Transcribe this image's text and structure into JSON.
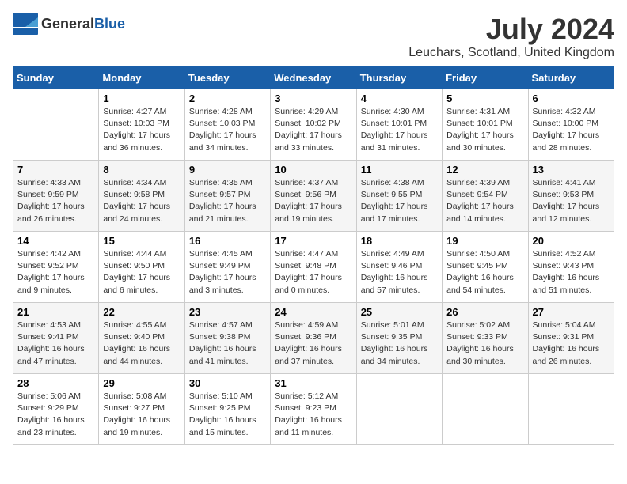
{
  "header": {
    "logo_general": "General",
    "logo_blue": "Blue",
    "title": "July 2024",
    "location": "Leuchars, Scotland, United Kingdom"
  },
  "weekdays": [
    "Sunday",
    "Monday",
    "Tuesday",
    "Wednesday",
    "Thursday",
    "Friday",
    "Saturday"
  ],
  "weeks": [
    [
      {
        "day": "",
        "details": ""
      },
      {
        "day": "1",
        "details": "Sunrise: 4:27 AM\nSunset: 10:03 PM\nDaylight: 17 hours\nand 36 minutes."
      },
      {
        "day": "2",
        "details": "Sunrise: 4:28 AM\nSunset: 10:03 PM\nDaylight: 17 hours\nand 34 minutes."
      },
      {
        "day": "3",
        "details": "Sunrise: 4:29 AM\nSunset: 10:02 PM\nDaylight: 17 hours\nand 33 minutes."
      },
      {
        "day": "4",
        "details": "Sunrise: 4:30 AM\nSunset: 10:01 PM\nDaylight: 17 hours\nand 31 minutes."
      },
      {
        "day": "5",
        "details": "Sunrise: 4:31 AM\nSunset: 10:01 PM\nDaylight: 17 hours\nand 30 minutes."
      },
      {
        "day": "6",
        "details": "Sunrise: 4:32 AM\nSunset: 10:00 PM\nDaylight: 17 hours\nand 28 minutes."
      }
    ],
    [
      {
        "day": "7",
        "details": "Sunrise: 4:33 AM\nSunset: 9:59 PM\nDaylight: 17 hours\nand 26 minutes."
      },
      {
        "day": "8",
        "details": "Sunrise: 4:34 AM\nSunset: 9:58 PM\nDaylight: 17 hours\nand 24 minutes."
      },
      {
        "day": "9",
        "details": "Sunrise: 4:35 AM\nSunset: 9:57 PM\nDaylight: 17 hours\nand 21 minutes."
      },
      {
        "day": "10",
        "details": "Sunrise: 4:37 AM\nSunset: 9:56 PM\nDaylight: 17 hours\nand 19 minutes."
      },
      {
        "day": "11",
        "details": "Sunrise: 4:38 AM\nSunset: 9:55 PM\nDaylight: 17 hours\nand 17 minutes."
      },
      {
        "day": "12",
        "details": "Sunrise: 4:39 AM\nSunset: 9:54 PM\nDaylight: 17 hours\nand 14 minutes."
      },
      {
        "day": "13",
        "details": "Sunrise: 4:41 AM\nSunset: 9:53 PM\nDaylight: 17 hours\nand 12 minutes."
      }
    ],
    [
      {
        "day": "14",
        "details": "Sunrise: 4:42 AM\nSunset: 9:52 PM\nDaylight: 17 hours\nand 9 minutes."
      },
      {
        "day": "15",
        "details": "Sunrise: 4:44 AM\nSunset: 9:50 PM\nDaylight: 17 hours\nand 6 minutes."
      },
      {
        "day": "16",
        "details": "Sunrise: 4:45 AM\nSunset: 9:49 PM\nDaylight: 17 hours\nand 3 minutes."
      },
      {
        "day": "17",
        "details": "Sunrise: 4:47 AM\nSunset: 9:48 PM\nDaylight: 17 hours\nand 0 minutes."
      },
      {
        "day": "18",
        "details": "Sunrise: 4:49 AM\nSunset: 9:46 PM\nDaylight: 16 hours\nand 57 minutes."
      },
      {
        "day": "19",
        "details": "Sunrise: 4:50 AM\nSunset: 9:45 PM\nDaylight: 16 hours\nand 54 minutes."
      },
      {
        "day": "20",
        "details": "Sunrise: 4:52 AM\nSunset: 9:43 PM\nDaylight: 16 hours\nand 51 minutes."
      }
    ],
    [
      {
        "day": "21",
        "details": "Sunrise: 4:53 AM\nSunset: 9:41 PM\nDaylight: 16 hours\nand 47 minutes."
      },
      {
        "day": "22",
        "details": "Sunrise: 4:55 AM\nSunset: 9:40 PM\nDaylight: 16 hours\nand 44 minutes."
      },
      {
        "day": "23",
        "details": "Sunrise: 4:57 AM\nSunset: 9:38 PM\nDaylight: 16 hours\nand 41 minutes."
      },
      {
        "day": "24",
        "details": "Sunrise: 4:59 AM\nSunset: 9:36 PM\nDaylight: 16 hours\nand 37 minutes."
      },
      {
        "day": "25",
        "details": "Sunrise: 5:01 AM\nSunset: 9:35 PM\nDaylight: 16 hours\nand 34 minutes."
      },
      {
        "day": "26",
        "details": "Sunrise: 5:02 AM\nSunset: 9:33 PM\nDaylight: 16 hours\nand 30 minutes."
      },
      {
        "day": "27",
        "details": "Sunrise: 5:04 AM\nSunset: 9:31 PM\nDaylight: 16 hours\nand 26 minutes."
      }
    ],
    [
      {
        "day": "28",
        "details": "Sunrise: 5:06 AM\nSunset: 9:29 PM\nDaylight: 16 hours\nand 23 minutes."
      },
      {
        "day": "29",
        "details": "Sunrise: 5:08 AM\nSunset: 9:27 PM\nDaylight: 16 hours\nand 19 minutes."
      },
      {
        "day": "30",
        "details": "Sunrise: 5:10 AM\nSunset: 9:25 PM\nDaylight: 16 hours\nand 15 minutes."
      },
      {
        "day": "31",
        "details": "Sunrise: 5:12 AM\nSunset: 9:23 PM\nDaylight: 16 hours\nand 11 minutes."
      },
      {
        "day": "",
        "details": ""
      },
      {
        "day": "",
        "details": ""
      },
      {
        "day": "",
        "details": ""
      }
    ]
  ]
}
